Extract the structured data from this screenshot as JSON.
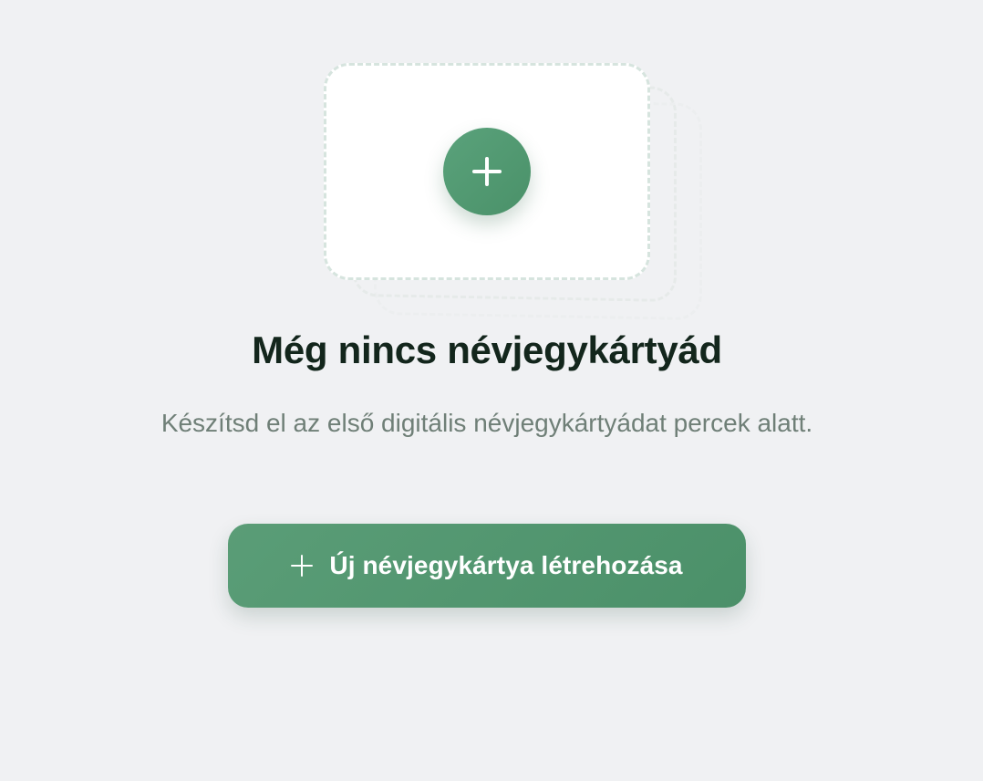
{
  "empty_state": {
    "title": "Még nincs névjegykártyád",
    "description": "Készítsd el az első digitális névjegykártyádat percek alatt.",
    "create_button_label": "Új névjegykártya létrehozása",
    "add_icon": "plus-icon",
    "button_icon": "plus-icon"
  },
  "colors": {
    "accent": "#4f9670",
    "background": "#f0f1f3",
    "title": "#13261c",
    "description": "#6f7f77"
  }
}
